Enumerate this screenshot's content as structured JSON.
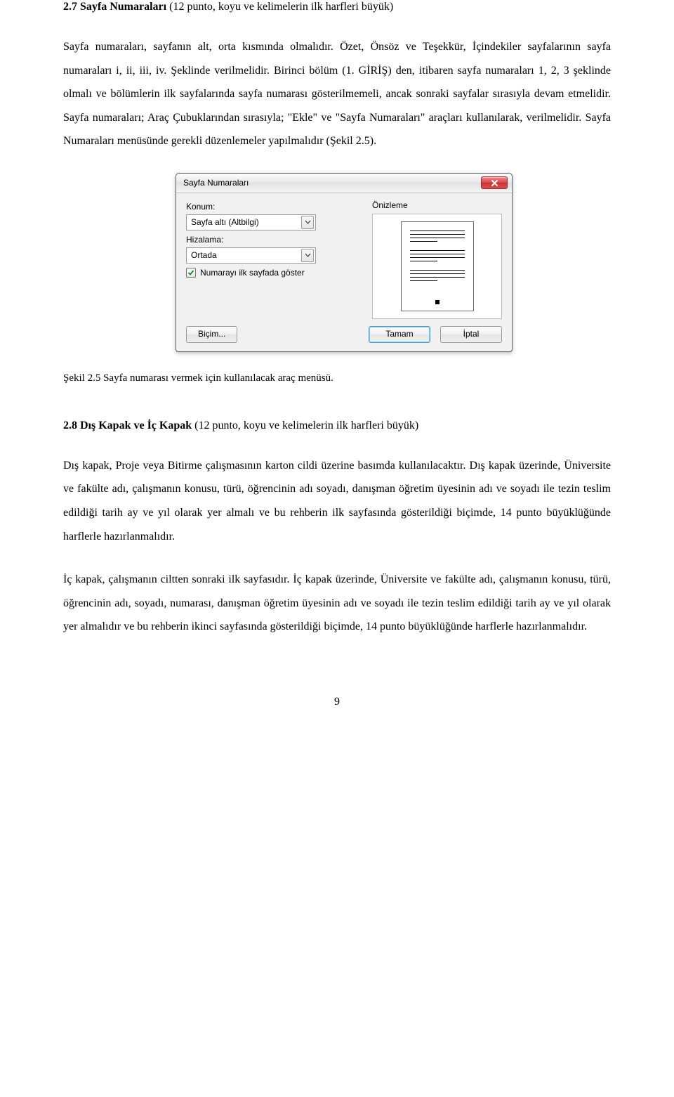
{
  "section27": {
    "title_prefix": "2.7 Sayfa Numaraları ",
    "title_hint": "(12 punto, koyu ve kelimelerin ilk harfleri büyük)",
    "paragraph": "Sayfa numaraları, sayfanın alt, orta kısmında olmalıdır. Özet, Önsöz ve Teşekkür, İçindekiler sayfalarının sayfa numaraları i, ii, iii, iv. Şeklinde verilmelidir. Birinci bölüm (1. GİRİŞ) den, itibaren sayfa numaraları 1, 2, 3 şeklinde olmalı ve bölümlerin ilk sayfalarında sayfa numarası gösterilmemeli, ancak sonraki sayfalar sırasıyla devam etmelidir. Sayfa numaraları; Araç Çubuklarından sırasıyla; \"Ekle\" ve \"Sayfa Numaraları\" araçları kullanılarak, verilmelidir. Sayfa Numaraları menüsünde gerekli düzenlemeler yapılmalıdır (Şekil 2.5)."
  },
  "dialog": {
    "title": "Sayfa Numaraları",
    "position_label": "Konum:",
    "position_value": "Sayfa altı (Altbilgi)",
    "align_label": "Hizalama:",
    "align_value": "Ortada",
    "show_first_label": "Numarayı ilk sayfada göster",
    "preview_label": "Önizleme",
    "format_btn": "Biçim...",
    "ok_btn": "Tamam",
    "cancel_btn": "İptal"
  },
  "caption25": "Şekil 2.5 Sayfa numarası vermek için kullanılacak araç menüsü.",
  "section28": {
    "title_prefix": "2.8 Dış Kapak ve İç Kapak ",
    "title_hint": "(12 punto, koyu ve kelimelerin ilk harfleri büyük)",
    "para1": "Dış kapak, Proje veya Bitirme çalışmasının karton cildi üzerine basımda kullanılacaktır. Dış kapak üzerinde, Üniversite ve fakülte adı, çalışmanın konusu, türü, öğrencinin adı soyadı, danışman öğretim üyesinin adı ve soyadı ile tezin teslim edildiği tarih ay ve yıl olarak yer almalı ve bu rehberin ilk sayfasında gösterildiği biçimde, 14 punto büyüklüğünde harflerle hazırlanmalıdır.",
    "para2": "İç kapak, çalışmanın ciltten sonraki ilk sayfasıdır. İç kapak üzerinde, Üniversite ve fakülte adı, çalışmanın konusu, türü, öğrencinin adı, soyadı, numarası, danışman öğretim üyesinin adı ve soyadı ile tezin teslim edildiği tarih ay ve yıl olarak yer almalıdır ve bu rehberin ikinci sayfasında gösterildiği biçimde, 14 punto büyüklüğünde harflerle hazırlanmalıdır."
  },
  "page_number": "9"
}
